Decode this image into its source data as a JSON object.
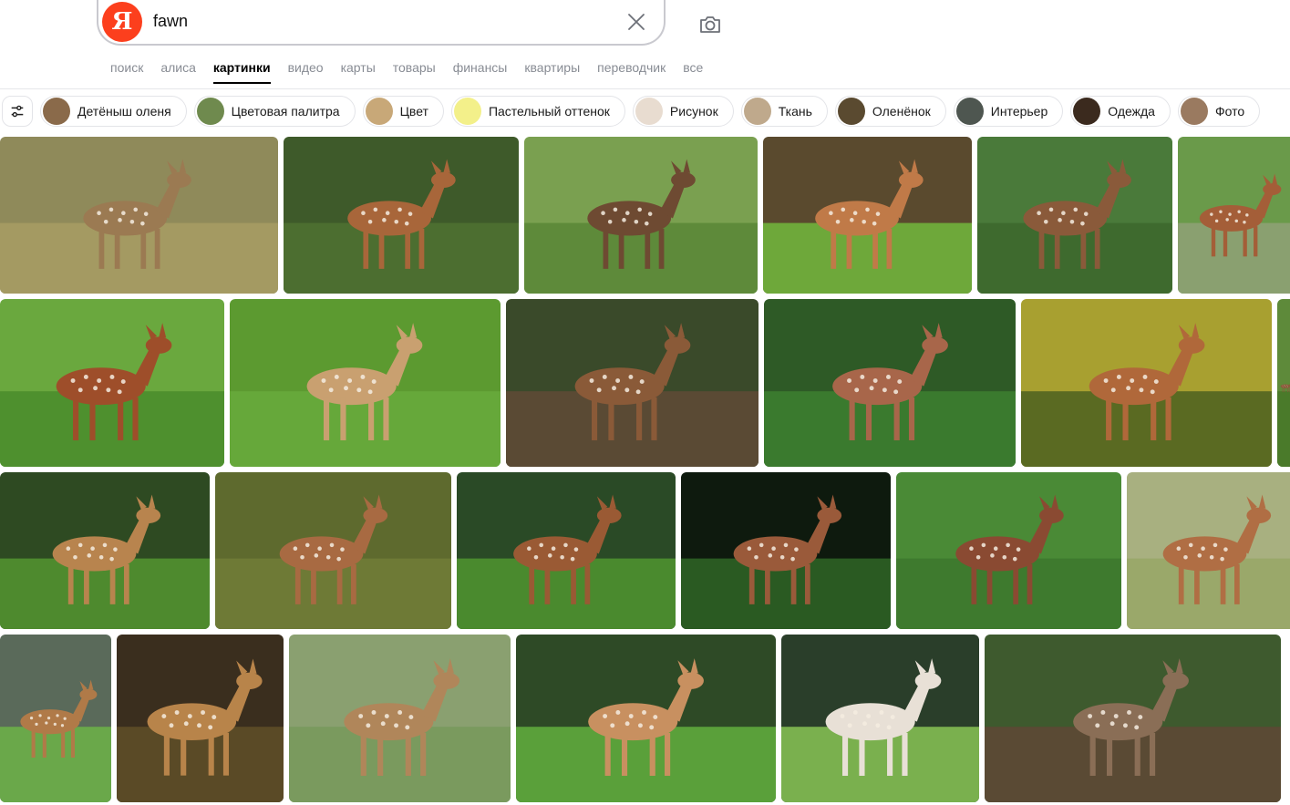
{
  "search": {
    "logo_letter": "Я",
    "query": "fawn",
    "clear_icon": "close-icon",
    "camera_icon": "camera-icon"
  },
  "tabs": [
    {
      "label": "поиск",
      "active": false
    },
    {
      "label": "алиса",
      "active": false
    },
    {
      "label": "картинки",
      "active": true
    },
    {
      "label": "видео",
      "active": false
    },
    {
      "label": "карты",
      "active": false
    },
    {
      "label": "товары",
      "active": false
    },
    {
      "label": "финансы",
      "active": false
    },
    {
      "label": "квартиры",
      "active": false
    },
    {
      "label": "переводчик",
      "active": false
    },
    {
      "label": "все",
      "active": false
    }
  ],
  "chips": [
    {
      "label": "Детёныш оленя",
      "color": "#8a6a4a"
    },
    {
      "label": "Цветовая палитра",
      "color": "#6f8a4e"
    },
    {
      "label": "Цвет",
      "color": "#c8a878"
    },
    {
      "label": "Пастельный оттенок",
      "color": "#f3f08a"
    },
    {
      "label": "Рисунок",
      "color": "#e8dcd0"
    },
    {
      "label": "Ткань",
      "color": "#bfa98c"
    },
    {
      "label": "Оленёнок",
      "color": "#5a4a30"
    },
    {
      "label": "Интерьер",
      "color": "#4e5650"
    },
    {
      "label": "Одежда",
      "color": "#3b2a1e"
    },
    {
      "label": "Фото",
      "color": "#9a7a60"
    }
  ],
  "accent_color": "#fc3f1d",
  "rows": [
    [
      {
        "bg": "#8f8a5a",
        "ground": "#a49a62",
        "deer": "#9b7a52"
      },
      {
        "bg": "#3e5a2a",
        "ground": "#4c6e30",
        "deer": "#a8663a"
      },
      {
        "bg": "#7aa050",
        "ground": "#5e8a3a",
        "deer": "#6e4a32"
      },
      {
        "bg": "#5a4a2e",
        "ground": "#6ea83a",
        "deer": "#c07a48"
      },
      {
        "bg": "#4a7a3a",
        "ground": "#3e6a2e",
        "deer": "#8a5a3a"
      },
      {
        "bg": "#6a9a4a",
        "ground": "#8aa070",
        "deer": "#a45e38"
      }
    ],
    [
      {
        "bg": "#6aa83e",
        "ground": "#4e902e",
        "deer": "#9e4e2a"
      },
      {
        "bg": "#5c9a30",
        "ground": "#66a83a",
        "deer": "#c9a070"
      },
      {
        "bg": "#3a4a2a",
        "ground": "#5a4a34",
        "deer": "#8a5a38"
      },
      {
        "bg": "#2e5a26",
        "ground": "#3a7a2e",
        "deer": "#a8664a"
      },
      {
        "bg": "#a8a030",
        "ground": "#5a6a22",
        "deer": "#b0683a"
      },
      {
        "bg": "#5e8a3a",
        "ground": "#4a7a2a",
        "deer": "#8a5a3a"
      }
    ],
    [
      {
        "bg": "#2e4a22",
        "ground": "#4e8a2e",
        "deer": "#b8844e"
      },
      {
        "bg": "#5e6a2e",
        "ground": "#6e7a36",
        "deer": "#a86a42"
      },
      {
        "bg": "#2a4a26",
        "ground": "#4a8a2e",
        "deer": "#9a5a34"
      },
      {
        "bg": "#0e1a0e",
        "ground": "#2a5a22",
        "deer": "#9a5a3a"
      },
      {
        "bg": "#4a8a36",
        "ground": "#3e7a2e",
        "deer": "#8a4a32"
      },
      {
        "bg": "#a8b080",
        "ground": "#9aa86a",
        "deer": "#b06e44"
      }
    ],
    [
      {
        "bg": "#5a6a5a",
        "ground": "#6aa84a",
        "deer": "#b07a48"
      },
      {
        "bg": "#3a2e1e",
        "ground": "#5a4a26",
        "deer": "#b8844a"
      },
      {
        "bg": "#8aa070",
        "ground": "#7a9a5e",
        "deer": "#b0865a"
      },
      {
        "bg": "#2e4a26",
        "ground": "#5aa03a",
        "deer": "#c89060"
      },
      {
        "bg": "#2a3e2a",
        "ground": "#7ab04e",
        "deer": "#e8e0d6"
      },
      {
        "bg": "#3e5a2e",
        "ground": "#5a4a34",
        "deer": "#8a6e56"
      }
    ]
  ]
}
